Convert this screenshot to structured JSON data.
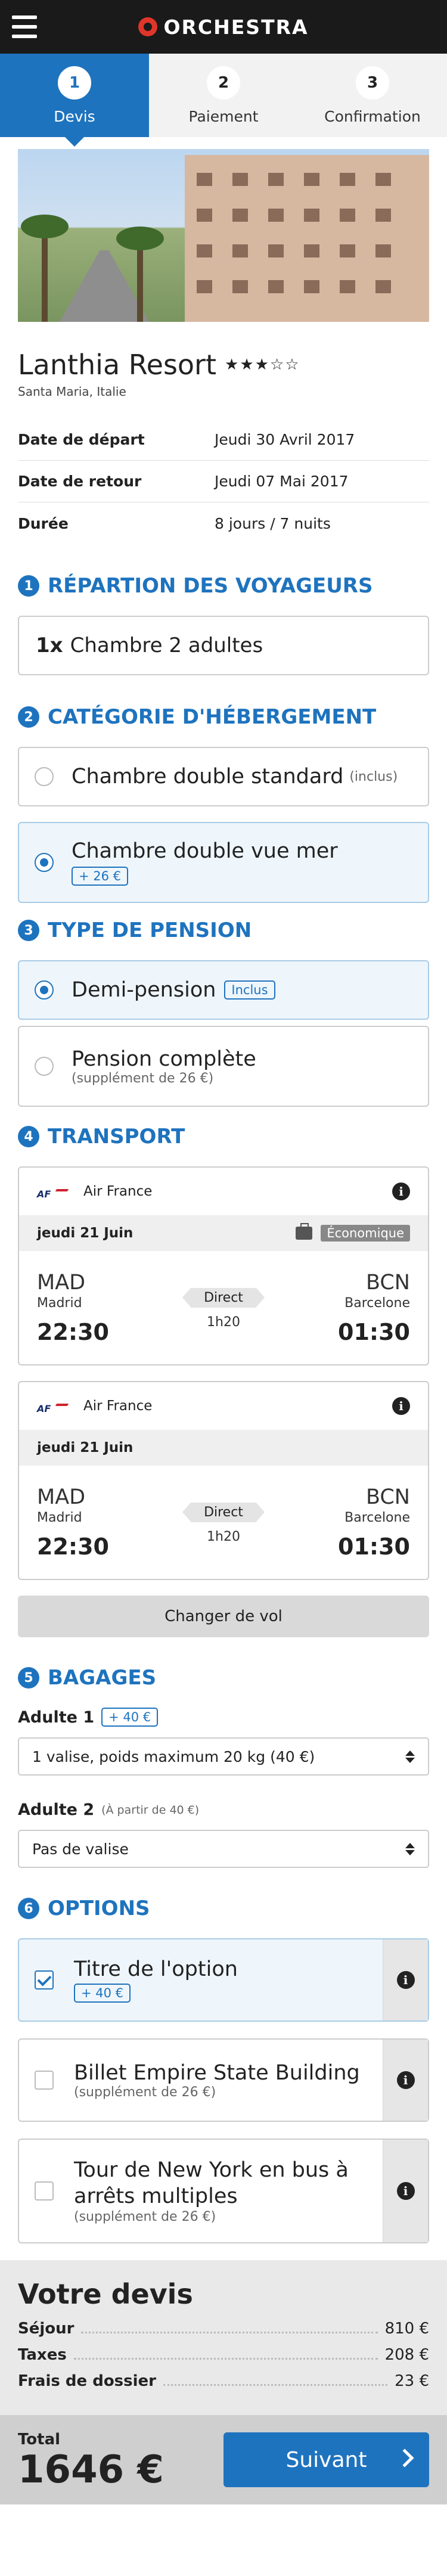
{
  "header": {
    "brand": "ORCHESTRA",
    "menu_icon": "hamburger-icon"
  },
  "steps": [
    {
      "num": "1",
      "label": "Devis",
      "active": true
    },
    {
      "num": "2",
      "label": "Paiement",
      "active": false
    },
    {
      "num": "3",
      "label": "Confirmation",
      "active": false
    }
  ],
  "hotel": {
    "name": "Lanthia Resort",
    "stars": "★★★☆☆",
    "rating": 3,
    "location": "Santa Maria, Italie"
  },
  "trip": [
    {
      "label": "Date de départ",
      "value": "Jeudi 30 Avril 2017"
    },
    {
      "label": "Date de retour",
      "value": "Jeudi 07 Mai 2017"
    },
    {
      "label": "Durée",
      "value": "8 jours / 7 nuits"
    }
  ],
  "sections": {
    "s1": {
      "num": "1",
      "title": "RÉPARTION DES VOYAGEURS"
    },
    "s2": {
      "num": "2",
      "title": "CATÉGORIE D'HÉBERGEMENT"
    },
    "s3": {
      "num": "3",
      "title": "TYPE DE PENSION"
    },
    "s4": {
      "num": "4",
      "title": "TRANSPORT"
    },
    "s5": {
      "num": "5",
      "title": "BAGAGES"
    },
    "s6": {
      "num": "6",
      "title": "OPTIONS"
    }
  },
  "rooms": {
    "qty": "1x",
    "label": "Chambre 2 adultes"
  },
  "accommodation": [
    {
      "label": "Chambre double standard",
      "note": "(inclus)",
      "tag": "",
      "selected": false
    },
    {
      "label": "Chambre double vue mer",
      "note": "",
      "tag": "+ 26 €",
      "selected": true
    }
  ],
  "pension": [
    {
      "label": "Demi-pension",
      "tag": "Inclus",
      "sub": "",
      "selected": true
    },
    {
      "label": "Pension complète",
      "tag": "",
      "sub": "(supplément de 26 €)",
      "selected": false
    }
  ],
  "flights": [
    {
      "airline": "Air France",
      "date": "jeudi 21 Juin",
      "class": "Économique",
      "from": {
        "code": "MAD",
        "city": "Madrid",
        "time": "22:30"
      },
      "to": {
        "code": "BCN",
        "city": "Barcelone",
        "time": "01:30"
      },
      "type": "Direct",
      "duration": "1h20"
    },
    {
      "airline": "Air France",
      "date": "jeudi 21 Juin",
      "class": "",
      "from": {
        "code": "MAD",
        "city": "Madrid",
        "time": "22:30"
      },
      "to": {
        "code": "BCN",
        "city": "Barcelone",
        "time": "01:30"
      },
      "type": "Direct",
      "duration": "1h20"
    }
  ],
  "change_flight": "Changer de vol",
  "baggage": [
    {
      "label": "Adulte 1",
      "tag": "+ 40 €",
      "note": "",
      "value": "1 valise, poids maximum 20 kg (40 €)"
    },
    {
      "label": "Adulte 2",
      "tag": "",
      "note": "(À partir de 40 €)",
      "value": "Pas de valise"
    }
  ],
  "options": [
    {
      "title": "Titre de l'option",
      "tag": "+ 40 €",
      "sub": "",
      "checked": true
    },
    {
      "title": "Billet Empire State Building",
      "tag": "",
      "sub": "(supplément de 26 €)",
      "checked": false
    },
    {
      "title": "Tour de New York en bus à arrêts multiples",
      "tag": "",
      "sub": "(supplément de 26 €)",
      "checked": false
    }
  ],
  "quote": {
    "title": "Votre devis",
    "lines": [
      {
        "label": "Séjour",
        "value": "810 €"
      },
      {
        "label": "Taxes",
        "value": "208 €"
      },
      {
        "label": "Frais de dossier",
        "value": "23 €"
      }
    ]
  },
  "footer": {
    "total_label": "Total",
    "total_value": "1646 €",
    "next_label": "Suivant"
  },
  "colors": {
    "accent": "#1e73be",
    "header_bg": "#1a1a1a",
    "brand_mark": "#e0352b"
  }
}
